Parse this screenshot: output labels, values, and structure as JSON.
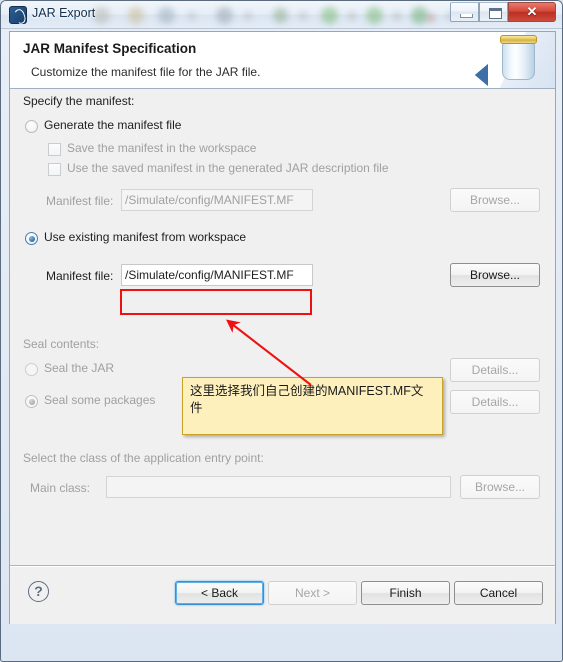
{
  "window": {
    "title": "JAR Export",
    "icon": "jar-export-icon",
    "controls": {
      "minimize": "minimize-icon",
      "maximize": "maximize-icon",
      "close": "✕"
    }
  },
  "header": {
    "title": "JAR Manifest Specification",
    "description": "Customize the manifest file for the JAR file.",
    "image": "jar-jar-icon"
  },
  "form": {
    "specify_group_label": "Specify the manifest:",
    "generate_radio": {
      "label": "Generate the manifest file",
      "selected": false,
      "enabled": true
    },
    "save_checkbox": {
      "label": "Save the manifest in the workspace",
      "checked": false,
      "enabled": false
    },
    "use_saved_checkbox": {
      "label": "Use the saved manifest in the generated JAR description file",
      "checked": false,
      "enabled": false
    },
    "manifest_file_disabled": {
      "label": "Manifest file:",
      "value": "/Simulate/config/MANIFEST.MF",
      "browse_label": "Browse...",
      "enabled": false
    },
    "use_existing_radio": {
      "label": "Use existing manifest from workspace",
      "selected": true,
      "enabled": true
    },
    "manifest_file_active": {
      "label": "Manifest file:",
      "value": "/Simulate/config/MANIFEST.MF",
      "browse_label": "Browse...",
      "enabled": true
    },
    "seal_group_label": "Seal contents:",
    "seal_jar_radio": {
      "label": "Seal the JAR",
      "selected": false,
      "enabled": false
    },
    "seal_jar_details_label": "Details...",
    "seal_packages_radio": {
      "label": "Seal some packages",
      "selected": true,
      "enabled": false
    },
    "seal_packages_details_label": "Details...",
    "entry_point_group_label": "Select the class of the application entry point:",
    "main_class": {
      "label": "Main class:",
      "value": "",
      "browse_label": "Browse...",
      "enabled": false
    }
  },
  "footer": {
    "help_label": "?",
    "back_label": "< Back",
    "next_label": "Next >",
    "finish_label": "Finish",
    "cancel_label": "Cancel",
    "back_focused": true,
    "next_enabled": false
  },
  "annotations": {
    "callout_text": "这里选择我们自己创建的MANIFEST.MF文件",
    "highlight_color": "#ee1111",
    "callout_bg": "#fdf0bc",
    "callout_border": "#c9a227",
    "arrow_color": "#ee1111"
  },
  "colors": {
    "accent_blue": "#2d73ab",
    "window_bg": "#f0f0f0",
    "close_red": "#d4493a",
    "focus_blue": "#3c8fcf"
  }
}
